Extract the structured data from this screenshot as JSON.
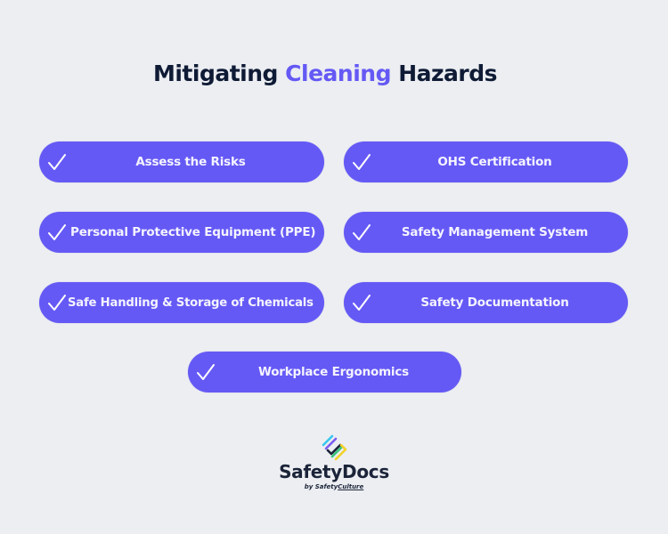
{
  "title": {
    "part1": "Mitigating",
    "accent": "Cleaning",
    "part2": "Hazards"
  },
  "colors": {
    "background": "#eceef2",
    "accent": "#6559f5",
    "title_text": "#0f1b35",
    "pill_text": "#f4f3ff"
  },
  "items": [
    {
      "label": "Assess the Risks",
      "icon": "check-icon"
    },
    {
      "label": "OHS Certification",
      "icon": "check-icon"
    },
    {
      "label": "Personal Protective Equipment (PPE)",
      "icon": "check-icon"
    },
    {
      "label": "Safety Management System",
      "icon": "check-icon"
    },
    {
      "label": "Safe Handling & Storage of Chemicals",
      "icon": "check-icon"
    },
    {
      "label": "Safety Documentation",
      "icon": "check-icon"
    },
    {
      "label": "Workplace Ergonomics",
      "icon": "check-icon"
    }
  ],
  "logo": {
    "name": "SafetyDocs",
    "by": "by",
    "company_a": "Safety",
    "company_b": "Culture",
    "icon": "safetydocs-logo-icon"
  }
}
